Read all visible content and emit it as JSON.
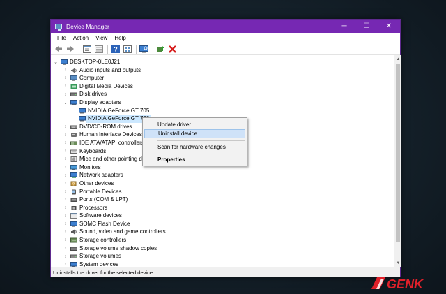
{
  "window": {
    "title": "Device Manager",
    "controls": {
      "minimize": "─",
      "maximize": "☐",
      "close": "✕"
    }
  },
  "menubar": {
    "items": [
      "File",
      "Action",
      "View",
      "Help"
    ]
  },
  "toolbar": {
    "buttons": [
      "back-icon",
      "forward-icon",
      "properties-icon",
      "show-hidden-icon",
      "help-icon",
      "view-icon",
      "scan-hardware-icon",
      "update-driver-icon",
      "uninstall-icon"
    ]
  },
  "tree": {
    "root": "DESKTOP-0LE0J21",
    "items": [
      {
        "label": "Audio inputs and outputs",
        "icon": "speaker-icon"
      },
      {
        "label": "Computer",
        "icon": "computer-icon"
      },
      {
        "label": "Digital Media Devices",
        "icon": "media-device-icon"
      },
      {
        "label": "Disk drives",
        "icon": "disk-drive-icon"
      },
      {
        "label": "Display adapters",
        "icon": "display-adapter-icon",
        "expanded": true,
        "children": [
          "NVIDIA GeForce GT 705",
          "NVIDIA GeForce GT 730"
        ]
      },
      {
        "label": "DVD/CD-ROM drives",
        "icon": "dvd-drive-icon"
      },
      {
        "label": "Human Interface Devices",
        "icon": "hid-icon"
      },
      {
        "label": "IDE ATA/ATAPI controllers",
        "icon": "ide-controller-icon"
      },
      {
        "label": "Keyboards",
        "icon": "keyboard-icon"
      },
      {
        "label": "Mice and other pointing d",
        "icon": "mouse-icon"
      },
      {
        "label": "Monitors",
        "icon": "monitor-icon"
      },
      {
        "label": "Network adapters",
        "icon": "network-adapter-icon"
      },
      {
        "label": "Other devices",
        "icon": "other-device-icon"
      },
      {
        "label": "Portable Devices",
        "icon": "portable-device-icon"
      },
      {
        "label": "Ports (COM & LPT)",
        "icon": "port-icon"
      },
      {
        "label": "Processors",
        "icon": "processor-icon"
      },
      {
        "label": "Software devices",
        "icon": "software-device-icon"
      },
      {
        "label": "SOMC Flash Device",
        "icon": "flash-device-icon"
      },
      {
        "label": "Sound, video and game controllers",
        "icon": "sound-controller-icon"
      },
      {
        "label": "Storage controllers",
        "icon": "storage-controller-icon"
      },
      {
        "label": "Storage volume shadow copies",
        "icon": "shadow-copy-icon"
      },
      {
        "label": "Storage volumes",
        "icon": "storage-volume-icon"
      },
      {
        "label": "System devices",
        "icon": "system-device-icon"
      }
    ],
    "selected": "NVIDIA GeForce GT 730"
  },
  "context_menu": {
    "items": [
      "Update driver",
      "Uninstall device",
      "Scan for hardware changes",
      "Properties"
    ],
    "highlighted": "Uninstall device"
  },
  "statusbar": {
    "text": "Uninstalls the driver for the selected device."
  },
  "watermark": {
    "text": "GENK"
  },
  "colors": {
    "titlebar": "#7628b3",
    "selection": "#cce8ff",
    "menu_highlight": "#cfe2f8",
    "logo_red": "#e0202a"
  }
}
